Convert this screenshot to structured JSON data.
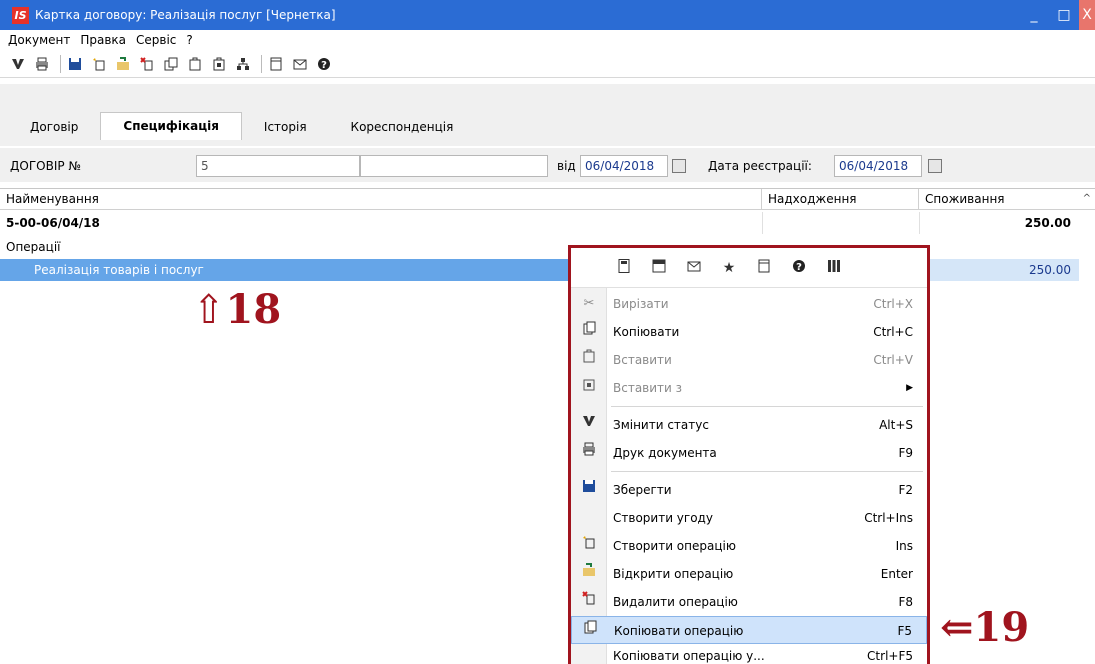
{
  "window": {
    "logo": "IS",
    "title": "Картка договору: Реалізація послуг [Чернетка]",
    "minimize": "_",
    "maximize": "□",
    "close": "X"
  },
  "menubar": [
    "Документ",
    "Правка",
    "Сервіс",
    "?"
  ],
  "toolbar_icons": [
    "status-icon",
    "print-icon",
    "save-icon",
    "create-icon",
    "open-icon",
    "delete-icon",
    "copy-icon",
    "copy-to-icon",
    "paste-icon",
    "tree-icon",
    "window-icon",
    "mail-icon",
    "help-icon"
  ],
  "tabs": [
    {
      "label": "Договір",
      "active": false
    },
    {
      "label": "Специфікація",
      "active": true
    },
    {
      "label": "Історія",
      "active": false
    },
    {
      "label": "Кореспонденція",
      "active": false
    }
  ],
  "form": {
    "contract_label": "ДОГОВІР №",
    "contract_number": "5",
    "contract_extra": "",
    "from_label": "від",
    "from_date": "06/04/2018",
    "reg_label": "Дата реєстрації:",
    "reg_date": "06/04/2018"
  },
  "grid": {
    "columns": [
      "Найменування",
      "Надходження",
      "Споживання"
    ],
    "rows": [
      {
        "name": "5-00-06/04/18",
        "income": "",
        "consumption": "250.00",
        "bold": true
      },
      {
        "name": "Операції",
        "income": "",
        "consumption": "",
        "bold": false
      },
      {
        "name": "Реалізація товарів і послуг",
        "income": "",
        "consumption": "250.00",
        "selected": true
      }
    ]
  },
  "annotations": {
    "arrow_18": "⇧18",
    "arrow_19": "⇐19"
  },
  "context_menu": {
    "items": [
      {
        "label": "Вирізати",
        "shortcut": "Ctrl+X",
        "icon": "cut-icon",
        "disabled": true
      },
      {
        "label": "Копіювати",
        "shortcut": "Ctrl+C",
        "icon": "copy-icon",
        "disabled": false
      },
      {
        "label": "Вставити",
        "shortcut": "Ctrl+V",
        "icon": "paste-icon",
        "disabled": true
      },
      {
        "label": "Вставити з",
        "shortcut": "",
        "icon": "paste-from-icon",
        "disabled": true,
        "submenu": true
      },
      {
        "label": "Змінити статус",
        "shortcut": "Alt+S",
        "icon": "status-icon",
        "disabled": false
      },
      {
        "label": "Друк документа",
        "shortcut": "F9",
        "icon": "print-icon",
        "disabled": false
      },
      {
        "label": "Зберегти",
        "shortcut": "F2",
        "icon": "save-icon",
        "disabled": false
      },
      {
        "label": "Створити угоду",
        "shortcut": "Ctrl+Ins",
        "icon": "",
        "disabled": false
      },
      {
        "label": "Створити операцію",
        "shortcut": "Ins",
        "icon": "create-operation-icon",
        "disabled": false
      },
      {
        "label": "Відкрити операцію",
        "shortcut": "Enter",
        "icon": "open-operation-icon",
        "disabled": false
      },
      {
        "label": "Видалити операцію",
        "shortcut": "F8",
        "icon": "delete-operation-icon",
        "disabled": false
      },
      {
        "label": "Копіювати операцію",
        "shortcut": "F5",
        "icon": "copy-operation-icon",
        "disabled": false,
        "highlighted": true
      },
      {
        "label": "Копіювати операцію у...",
        "shortcut": "Ctrl+F5",
        "icon": "",
        "disabled": false
      }
    ]
  }
}
